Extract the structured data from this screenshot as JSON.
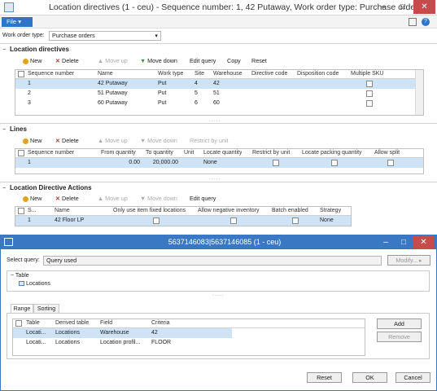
{
  "main_window": {
    "title": "Location directives (1 - ceu) - Sequence number: 1, 42 Putaway, Work order type: Purchase orders",
    "file_menu": "File",
    "work_order_type_label": "Work order type:",
    "work_order_type_value": "Purchase orders"
  },
  "location_directives": {
    "title": "Location directives",
    "toolbar": {
      "new": "New",
      "delete": "Delete",
      "move_up": "Move up",
      "move_down": "Move down",
      "edit_query": "Edit query",
      "copy": "Copy",
      "reset": "Reset"
    },
    "headers": [
      "Sequence number",
      "Name",
      "Work type",
      "Site",
      "Warehouse",
      "Directive code",
      "Disposition code",
      "Multiple SKU"
    ],
    "rows": [
      {
        "seq": "1",
        "name": "42 Putaway",
        "work_type": "Put",
        "site": "4",
        "warehouse": "42"
      },
      {
        "seq": "2",
        "name": "51 Putaway",
        "work_type": "Put",
        "site": "5",
        "warehouse": "51"
      },
      {
        "seq": "3",
        "name": "60 Putaway",
        "work_type": "Put",
        "site": "6",
        "warehouse": "60"
      }
    ]
  },
  "lines": {
    "title": "Lines",
    "toolbar": {
      "new": "New",
      "delete": "Delete",
      "move_up": "Move up",
      "move_down": "Move down",
      "restrict": "Restrict by unit"
    },
    "headers": [
      "Sequence number",
      "From quantity",
      "To quantity",
      "Unit",
      "Locate quantity",
      "Restrict by unit",
      "Locate packing quantity",
      "Allow split"
    ],
    "rows": [
      {
        "seq": "1",
        "from": "0.00",
        "to": "20,000.00",
        "unit": "",
        "locate": "None"
      }
    ]
  },
  "actions": {
    "title": "Location Directive Actions",
    "toolbar": {
      "new": "New",
      "delete": "Delete",
      "move_up": "Move up",
      "move_down": "Move down",
      "edit_query": "Edit query"
    },
    "headers": [
      "S...",
      "Name",
      "Only use item fixed locations",
      "Allow negative inventory",
      "Batch enabled",
      "Strategy"
    ],
    "rows": [
      {
        "seq": "1",
        "name": "42 Floor LP",
        "strategy": "None"
      }
    ]
  },
  "query_dialog": {
    "title": "5637146083|5637146085 (1 - ceu)",
    "select_query_label": "Select query:",
    "select_query_value": "Query used",
    "modify_button": "Modify...",
    "tree": {
      "root": "Table",
      "child": "Locations"
    },
    "tabs": [
      "Range",
      "Sorting"
    ],
    "range_headers": [
      "Table",
      "Derived table",
      "Field",
      "Criteria"
    ],
    "range_rows": [
      {
        "table": "Locati...",
        "derived": "Locations",
        "field": "Warehouse",
        "criteria": "42"
      },
      {
        "table": "Locati...",
        "derived": "Locations",
        "field": "Location profil...",
        "criteria": "FLOOR"
      }
    ],
    "add_button": "Add",
    "remove_button": "Remove",
    "reset_button": "Reset",
    "ok_button": "OK",
    "cancel_button": "Cancel"
  },
  "colors": {
    "accent": "#2e75c7",
    "dialog_title": "#3a78c3",
    "close": "#c74b4b",
    "selected_row": "#cfe3f7"
  }
}
